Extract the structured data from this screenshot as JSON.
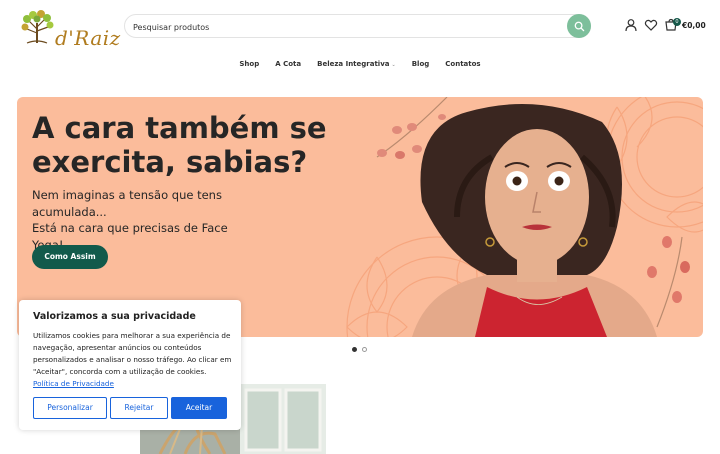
{
  "header": {
    "logo_text": "d'Raiz",
    "search_placeholder": "Pesquisar produtos",
    "cart_count": "0",
    "cart_total": "€0,00"
  },
  "nav": {
    "items": [
      "Shop",
      "A Cota",
      "Beleza Integrativa",
      "Blog",
      "Contatos"
    ]
  },
  "hero": {
    "title": "A cara também se exercita, sabias?",
    "subtitle_line1": "Nem imaginas a tensão que tens acumulada...",
    "subtitle_line2": "Está na cara que precisas de Face Yoga!",
    "cta_label": "Como Assim"
  },
  "slider": {
    "slide_count": 2,
    "active_index": 0
  },
  "cookie": {
    "title": "Valorizamos a sua privacidade",
    "text": "Utilizamos cookies para melhorar a sua experiência de navegação, apresentar anúncios ou conteúdos personalizados e analisar o nosso tráfego. Ao clicar em \"Aceitar\", concorda com a utilização de cookies.",
    "link_label": "Política de Privacidade",
    "customize_label": "Personalizar",
    "reject_label": "Rejeitar",
    "accept_label": "Aceitar"
  },
  "colors": {
    "brand_green": "#125a4b",
    "search_button": "#7dbf9b",
    "hero_background": "#fbbc9b",
    "cookie_blue": "#1863dc"
  }
}
